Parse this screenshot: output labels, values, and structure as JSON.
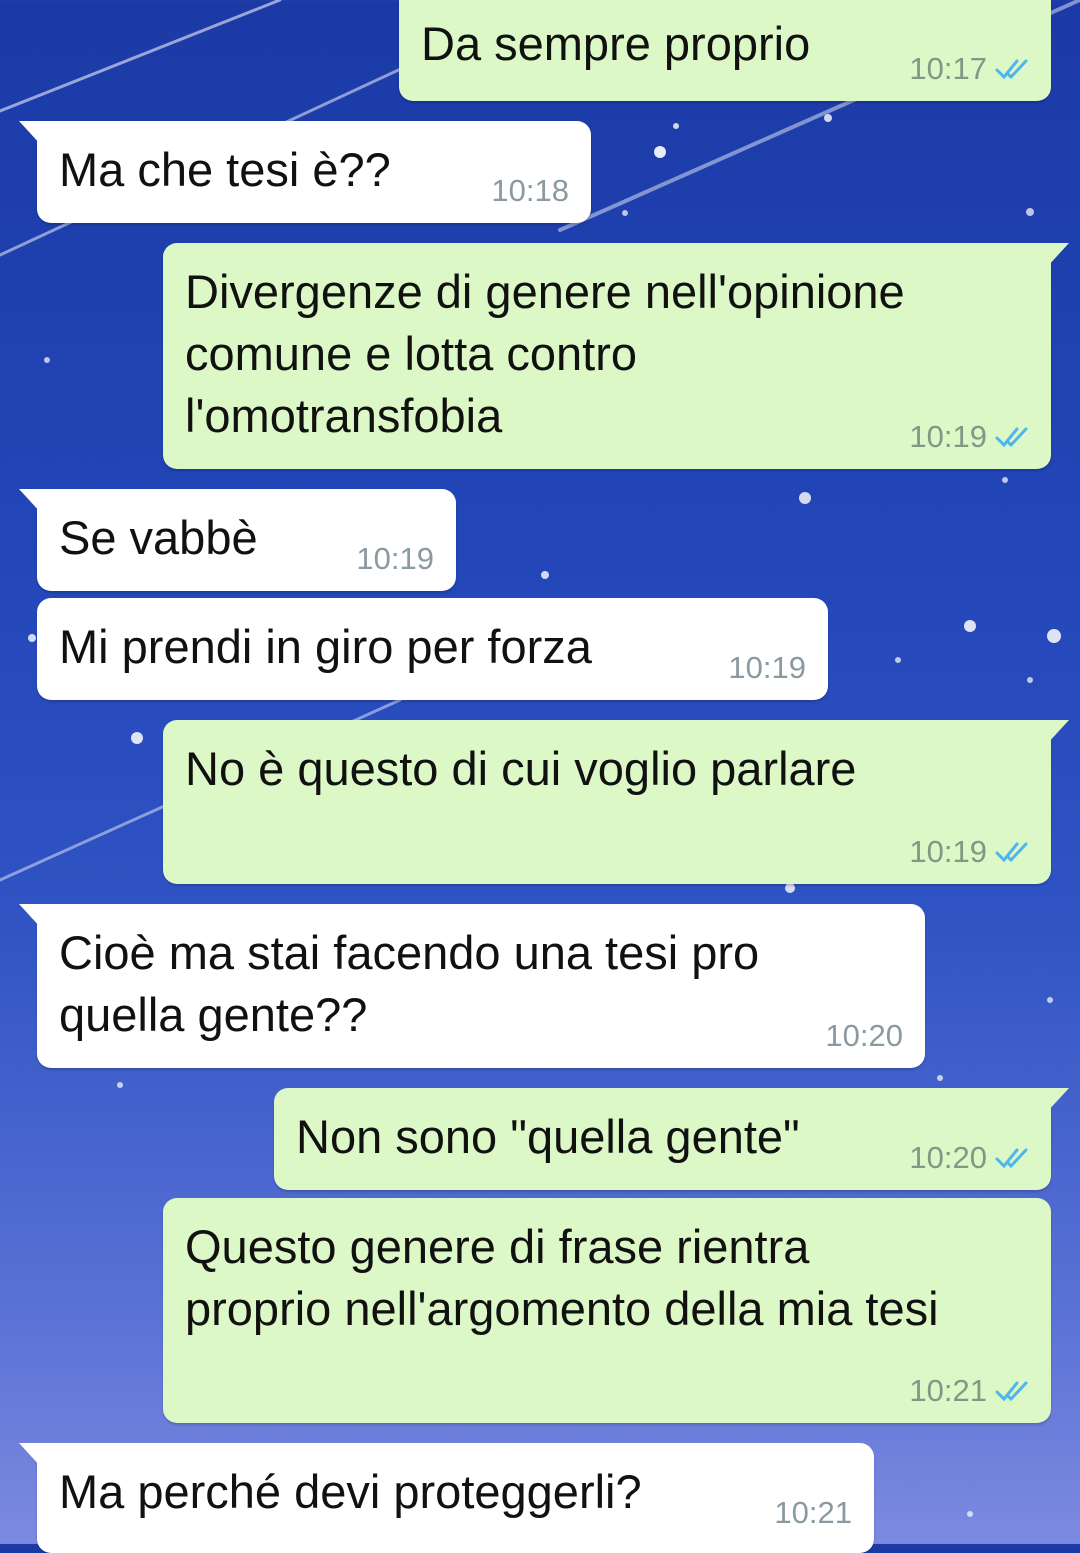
{
  "chat": {
    "messages": [
      {
        "direction": "outgoing",
        "text": "Da sempre proprio",
        "time": "10:17",
        "status": "read"
      },
      {
        "direction": "incoming",
        "text": "Ma che tesi è??",
        "time": "10:18"
      },
      {
        "direction": "outgoing",
        "text": "Divergenze di genere nell'opinione\ncomune e lotta contro\nl'omotransfobia",
        "time": "10:19",
        "status": "read"
      },
      {
        "direction": "incoming",
        "text": "Se vabbè",
        "time": "10:19"
      },
      {
        "direction": "incoming",
        "text": "Mi prendi in giro per forza",
        "time": "10:19"
      },
      {
        "direction": "outgoing",
        "text": "No è questo di cui voglio parlare",
        "time": "10:19",
        "status": "read"
      },
      {
        "direction": "incoming",
        "text": "Cioè ma stai facendo una tesi pro\nquella gente??",
        "time": "10:20"
      },
      {
        "direction": "outgoing",
        "text": "Non sono \"quella gente\"",
        "time": "10:20",
        "status": "read"
      },
      {
        "direction": "outgoing",
        "text": "Questo genere di frase rientra\nproprio nell'argomento della mia tesi",
        "time": "10:21",
        "status": "read"
      },
      {
        "direction": "incoming",
        "text": "Ma perché devi proteggerli?",
        "time": "10:21"
      }
    ]
  },
  "colors": {
    "incoming_bubble": "#ffffff",
    "outgoing_bubble": "#dcf8c6",
    "read_tick": "#4fb6ec",
    "background_top": "#1b3aa6",
    "background_bottom": "#7d8ae0"
  },
  "icons": {
    "read_status": "double-check-icon"
  }
}
